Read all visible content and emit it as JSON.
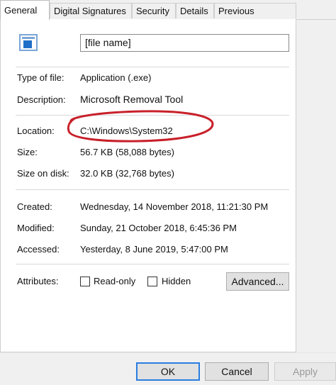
{
  "tabs": [
    "General",
    "Digital Signatures",
    "Security",
    "Details",
    "Previous Versions"
  ],
  "file_name": "[file name]",
  "type": {
    "label": "Type of file:",
    "value": "Application (.exe)"
  },
  "description": {
    "label": "Description:",
    "value": "Microsoft Removal Tool"
  },
  "location": {
    "label": "Location:",
    "value": "C:\\Windows\\System32"
  },
  "size": {
    "label": "Size:",
    "value": "56.7 KB (58,088 bytes)"
  },
  "size_on_disk": {
    "label": "Size on disk:",
    "value": "32.0 KB (32,768 bytes)"
  },
  "created": {
    "label": "Created:",
    "value": "Wednesday, 14 November 2018, 11:21:30 PM"
  },
  "modified": {
    "label": "Modified:",
    "value": "Sunday, 21 October 2018, 6:45:36 PM"
  },
  "accessed": {
    "label": "Accessed:",
    "value": "Yesterday, 8 June 2019, 5:47:00 PM"
  },
  "attributes": {
    "label": "Attributes:",
    "readonly": "Read-only",
    "hidden": "Hidden",
    "advanced": "Advanced..."
  },
  "buttons": {
    "ok": "OK",
    "cancel": "Cancel",
    "apply": "Apply"
  },
  "colors": {
    "annotation": "#c8202a",
    "ok_border": "#2a7de1"
  },
  "icons": {
    "file": "application-window-icon"
  }
}
